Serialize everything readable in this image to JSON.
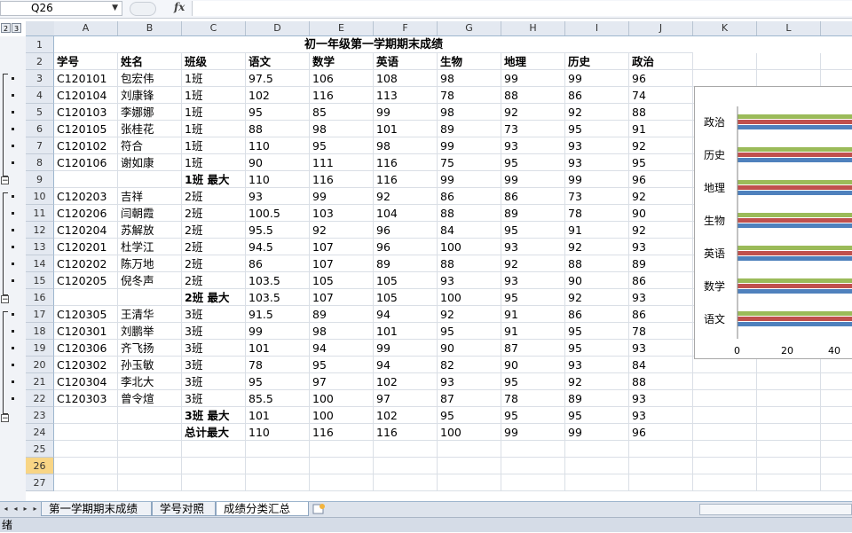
{
  "formula_bar": {
    "name_box": "Q26",
    "fx_label": "fx",
    "formula": ""
  },
  "outline_levels": [
    "2",
    "3"
  ],
  "columns": [
    "A",
    "B",
    "C",
    "D",
    "E",
    "F",
    "G",
    "H",
    "I",
    "J",
    "K",
    "L"
  ],
  "title": "初一年级第一学期期末成绩",
  "rows": [
    {
      "n": "2",
      "cells": [
        "学号",
        "姓名",
        "班级",
        "语文",
        "数学",
        "英语",
        "生物",
        "地理",
        "历史",
        "政治"
      ],
      "bold": true
    },
    {
      "n": "3",
      "cells": [
        "C120101",
        "包宏伟",
        "1班",
        "97.5",
        "106",
        "108",
        "98",
        "99",
        "99",
        "96"
      ]
    },
    {
      "n": "4",
      "cells": [
        "C120104",
        "刘康锋",
        "1班",
        "102",
        "116",
        "113",
        "78",
        "88",
        "86",
        "74"
      ]
    },
    {
      "n": "5",
      "cells": [
        "C120103",
        "李娜娜",
        "1班",
        "95",
        "85",
        "99",
        "98",
        "92",
        "92",
        "88"
      ]
    },
    {
      "n": "6",
      "cells": [
        "C120105",
        "张桂花",
        "1班",
        "88",
        "98",
        "101",
        "89",
        "73",
        "95",
        "91"
      ]
    },
    {
      "n": "7",
      "cells": [
        "C120102",
        "符合",
        "1班",
        "110",
        "95",
        "98",
        "99",
        "93",
        "93",
        "92"
      ]
    },
    {
      "n": "8",
      "cells": [
        "C120106",
        "谢如康",
        "1班",
        "90",
        "111",
        "116",
        "75",
        "95",
        "93",
        "95"
      ]
    },
    {
      "n": "9",
      "cells": [
        "",
        "",
        "1班  最大",
        "110",
        "116",
        "116",
        "99",
        "99",
        "99",
        "96"
      ],
      "subtotal": true
    },
    {
      "n": "10",
      "cells": [
        "C120203",
        "吉祥",
        "2班",
        "93",
        "99",
        "92",
        "86",
        "86",
        "73",
        "92"
      ]
    },
    {
      "n": "11",
      "cells": [
        "C120206",
        "闫朝霞",
        "2班",
        "100.5",
        "103",
        "104",
        "88",
        "89",
        "78",
        "90"
      ]
    },
    {
      "n": "12",
      "cells": [
        "C120204",
        "苏解放",
        "2班",
        "95.5",
        "92",
        "96",
        "84",
        "95",
        "91",
        "92"
      ]
    },
    {
      "n": "13",
      "cells": [
        "C120201",
        "杜学江",
        "2班",
        "94.5",
        "107",
        "96",
        "100",
        "93",
        "92",
        "93"
      ]
    },
    {
      "n": "14",
      "cells": [
        "C120202",
        "陈万地",
        "2班",
        "86",
        "107",
        "89",
        "88",
        "92",
        "88",
        "89"
      ]
    },
    {
      "n": "15",
      "cells": [
        "C120205",
        "倪冬声",
        "2班",
        "103.5",
        "105",
        "105",
        "93",
        "93",
        "90",
        "86"
      ]
    },
    {
      "n": "16",
      "cells": [
        "",
        "",
        "2班  最大",
        "103.5",
        "107",
        "105",
        "100",
        "95",
        "92",
        "93"
      ],
      "subtotal": true
    },
    {
      "n": "17",
      "cells": [
        "C120305",
        "王清华",
        "3班",
        "91.5",
        "89",
        "94",
        "92",
        "91",
        "86",
        "86"
      ]
    },
    {
      "n": "18",
      "cells": [
        "C120301",
        "刘鹏举",
        "3班",
        "99",
        "98",
        "101",
        "95",
        "91",
        "95",
        "78"
      ]
    },
    {
      "n": "19",
      "cells": [
        "C120306",
        "齐飞扬",
        "3班",
        "101",
        "94",
        "99",
        "90",
        "87",
        "95",
        "93"
      ]
    },
    {
      "n": "20",
      "cells": [
        "C120302",
        "孙玉敏",
        "3班",
        "78",
        "95",
        "94",
        "82",
        "90",
        "93",
        "84"
      ]
    },
    {
      "n": "21",
      "cells": [
        "C120304",
        "李北大",
        "3班",
        "95",
        "97",
        "102",
        "93",
        "95",
        "92",
        "88"
      ]
    },
    {
      "n": "22",
      "cells": [
        "C120303",
        "曾令煊",
        "3班",
        "85.5",
        "100",
        "97",
        "87",
        "78",
        "89",
        "93"
      ]
    },
    {
      "n": "23",
      "cells": [
        "",
        "",
        "3班  最大",
        "101",
        "100",
        "102",
        "95",
        "95",
        "95",
        "93"
      ],
      "subtotal": true
    },
    {
      "n": "24",
      "cells": [
        "",
        "",
        "总计最大",
        "110",
        "116",
        "116",
        "100",
        "99",
        "99",
        "96"
      ],
      "subtotal": true
    },
    {
      "n": "25",
      "cells": [
        "",
        "",
        "",
        "",
        "",
        "",
        "",
        "",
        "",
        ""
      ]
    },
    {
      "n": "26",
      "cells": [
        "",
        "",
        "",
        "",
        "",
        "",
        "",
        "",
        "",
        ""
      ],
      "selected": true
    },
    {
      "n": "27",
      "cells": [
        "",
        "",
        "",
        "",
        "",
        "",
        "",
        "",
        "",
        ""
      ]
    }
  ],
  "chart": {
    "categories": [
      "政治",
      "历史",
      "地理",
      "生物",
      "英语",
      "数学",
      "语文"
    ],
    "x_ticks": [
      "0",
      "20",
      "40"
    ],
    "series_colors": [
      "#9bbb59",
      "#c0504d",
      "#4f81bd"
    ]
  },
  "sheet_tabs": [
    "第一学期期末成绩",
    "学号对照",
    "成绩分类汇总"
  ],
  "active_tab": 2,
  "status": "绪"
}
